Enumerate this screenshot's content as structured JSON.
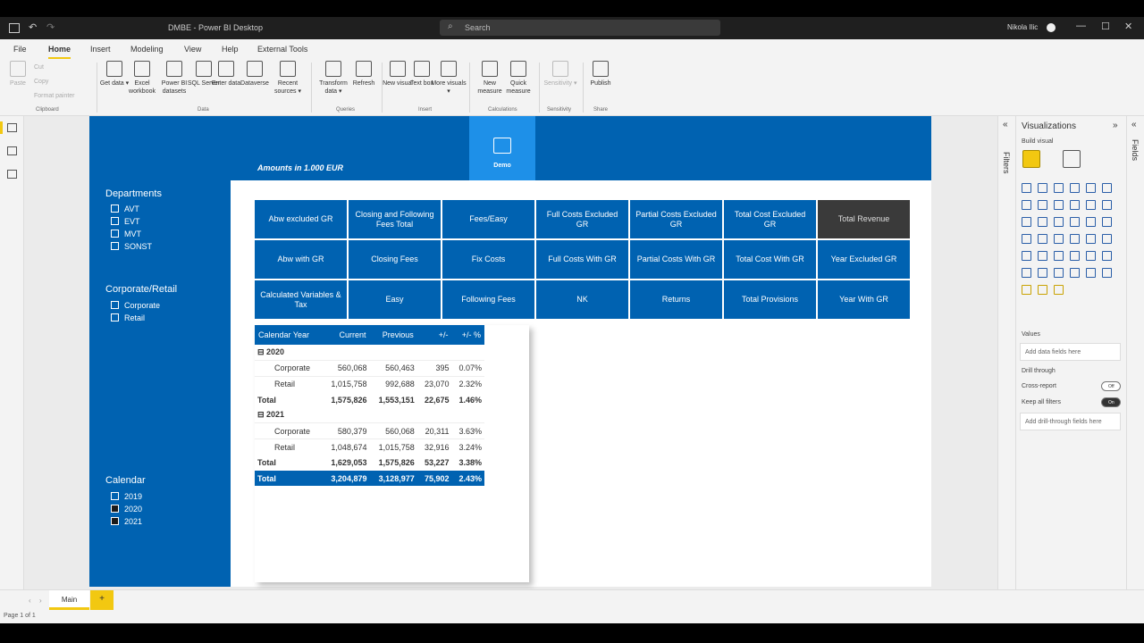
{
  "titlebar": {
    "doc_title": "DMBE - Power BI Desktop",
    "search_label": "Search",
    "user": "Nikola Ilic",
    "undo_glyph": "↶",
    "redo_glyph": "↷",
    "search_glyph": "⌕",
    "min_glyph": "—",
    "max_glyph": "☐",
    "close_glyph": "✕"
  },
  "ribbon": {
    "tabs": [
      "File",
      "Home",
      "Insert",
      "Modeling",
      "View",
      "Help",
      "External Tools"
    ],
    "active_tab": "Home",
    "clipboard": {
      "paste": "Paste",
      "cut": "Cut",
      "copy": "Copy",
      "format_painter": "Format painter",
      "group": "Clipboard"
    },
    "data": {
      "get_data": "Get data ▾",
      "excel": "Excel workbook",
      "pbi_datasets": "Power BI datasets",
      "sql": "SQL Server",
      "enter_data": "Enter data",
      "dataverse": "Dataverse",
      "recent": "Recent sources ▾",
      "group": "Data"
    },
    "queries": {
      "transform": "Transform data ▾",
      "refresh": "Refresh",
      "group": "Queries"
    },
    "insert": {
      "new_visual": "New visual",
      "text_box": "Text box",
      "more_visuals": "More visuals ▾",
      "group": "Insert"
    },
    "calculations": {
      "new_measure": "New measure",
      "quick_measure": "Quick measure",
      "group": "Calculations"
    },
    "sensitivity": {
      "label": "Sensitivity ▾",
      "group": "Sensitivity"
    },
    "share": {
      "publish": "Publish",
      "group": "Share"
    }
  },
  "report": {
    "amounts_title": "Amounts in 1.000 EUR",
    "demo_button": "Demo",
    "slicers": [
      {
        "title": "Departments",
        "items": [
          {
            "label": "AVT",
            "checked": false
          },
          {
            "label": "EVT",
            "checked": false
          },
          {
            "label": "MVT",
            "checked": false
          },
          {
            "label": "SONST",
            "checked": false
          }
        ]
      },
      {
        "title": "Corporate/Retail",
        "items": [
          {
            "label": "Corporate",
            "checked": false
          },
          {
            "label": "Retail",
            "checked": false
          }
        ]
      },
      {
        "title": "Calendar",
        "items": [
          {
            "label": "2019",
            "checked": false
          },
          {
            "label": "2020",
            "checked": true
          },
          {
            "label": "2021",
            "checked": true
          }
        ]
      }
    ],
    "measure_buttons": [
      "Abw excluded GR",
      "Closing and Following Fees Total",
      "Fees/Easy",
      "Full Costs Excluded GR",
      "Partial Costs Excluded GR",
      "Total Cost Excluded GR",
      "Total Revenue",
      "Abw with GR",
      "Closing Fees",
      "Fix Costs",
      "Full Costs With GR",
      "Partial Costs With GR",
      "Total Cost With GR",
      "Year Excluded GR",
      "Calculated Variables & Tax",
      "Easy",
      "Following Fees",
      "NK",
      "Returns",
      "Total Provisions",
      "Year With GR"
    ],
    "selected_measure": "Total Revenue",
    "matrix": {
      "headers": [
        "Calendar Year",
        "Current",
        "Previous",
        "+/-",
        "+/- %"
      ],
      "rows": [
        {
          "type": "year",
          "cells": [
            "⊟ 2020",
            "",
            "",
            "",
            ""
          ]
        },
        {
          "type": "sub",
          "cells": [
            "Corporate",
            "560,068",
            "560,463",
            "395",
            "0.07%"
          ]
        },
        {
          "type": "sub",
          "cells": [
            "Retail",
            "1,015,758",
            "992,688",
            "23,070",
            "2.32%"
          ]
        },
        {
          "type": "total",
          "cells": [
            "Total",
            "1,575,826",
            "1,553,151",
            "22,675",
            "1.46%"
          ]
        },
        {
          "type": "year",
          "cells": [
            "⊟ 2021",
            "",
            "",
            "",
            ""
          ]
        },
        {
          "type": "sub",
          "cells": [
            "Corporate",
            "580,379",
            "560,068",
            "20,311",
            "3.63%"
          ]
        },
        {
          "type": "sub",
          "cells": [
            "Retail",
            "1,048,674",
            "1,015,758",
            "32,916",
            "3.24%"
          ]
        },
        {
          "type": "total",
          "cells": [
            "Total",
            "1,629,053",
            "1,575,826",
            "53,227",
            "3.38%"
          ]
        },
        {
          "type": "grand",
          "cells": [
            "Total",
            "3,204,879",
            "3,128,977",
            "75,902",
            "2.43%"
          ]
        }
      ]
    }
  },
  "filters_label": "Filters",
  "fields_label": "Fields",
  "visualizations": {
    "title": "Visualizations",
    "build_visual": "Build visual",
    "values": "Values",
    "add_fields": "Add data fields here",
    "drill_through": "Drill through",
    "cross_report": "Cross-report",
    "cross_report_toggle": "Off",
    "keep_all_filters": "Keep all filters",
    "keep_all_toggle": "On",
    "add_drill": "Add drill-through fields here",
    "collapse_glyph": "»",
    "expand_glyph": "«"
  },
  "pages": {
    "tab": "Main",
    "add": "+",
    "status": "Page 1 of 1",
    "prev_glyph": "‹",
    "next_glyph": "›"
  }
}
